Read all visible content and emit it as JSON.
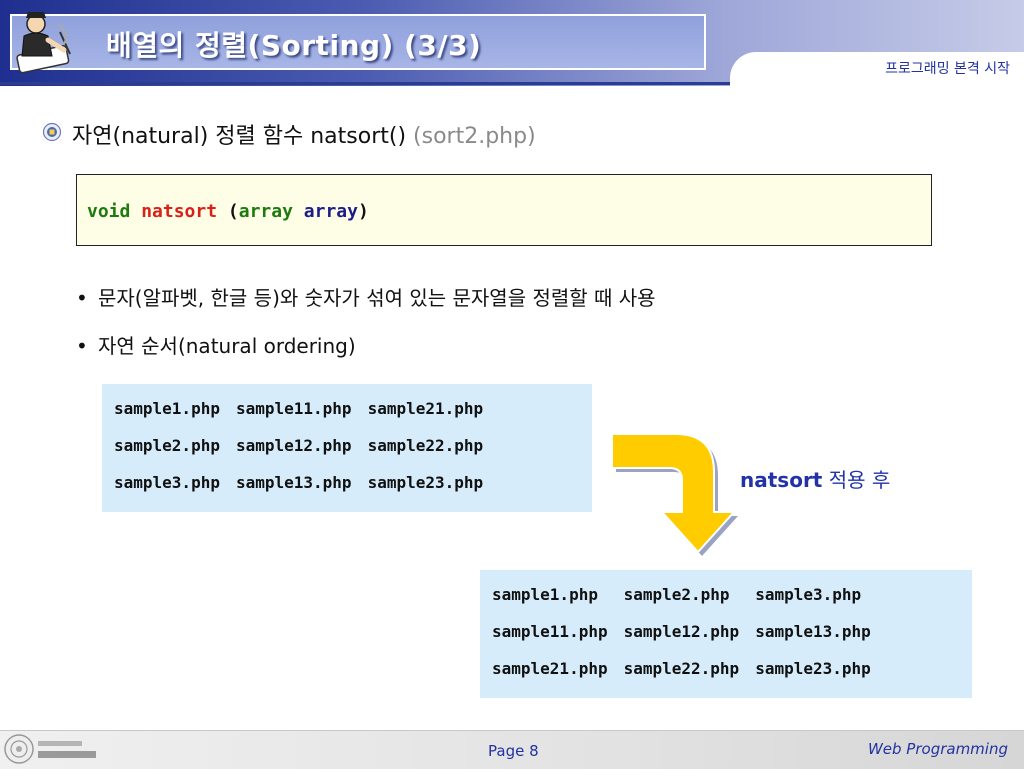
{
  "header": {
    "title": "배열의 정렬(Sorting) (3/3)",
    "subtitle": "프로그래밍 본격 시작"
  },
  "main_bullet": {
    "text": "자연(natural) 정렬 함수 natsort() ",
    "file": "(sort2.php)"
  },
  "code": {
    "kw_void": "void",
    "fn_name": "natsort",
    "paren_open": "(",
    "kw_array": "array",
    "param": "array",
    "paren_close": ")"
  },
  "bullets": [
    "문자(알파벳, 한글 등)와 숫자가 섞여 있는 문자열을 정렬할 때 사용",
    "자연 순서(natural ordering)"
  ],
  "before_table": [
    [
      "sample1.php",
      "sample11.php",
      "sample21.php"
    ],
    [
      "sample2.php",
      "sample12.php",
      "sample22.php"
    ],
    [
      "sample3.php",
      "sample13.php",
      "sample23.php"
    ]
  ],
  "after_table": [
    [
      "sample1.php",
      "sample2.php",
      "sample3.php"
    ],
    [
      "sample11.php",
      "sample12.php",
      "sample13.php"
    ],
    [
      "sample21.php",
      "sample22.php",
      "sample23.php"
    ]
  ],
  "after_label": {
    "fn": "natsort",
    "text": " 적용 후"
  },
  "footer": {
    "page": "Page 8",
    "course": "Web Programming"
  },
  "colors": {
    "header_dark": "#1f2f8f",
    "code_bg": "#fefee6",
    "table_bg": "#d6ecfb",
    "arrow": "#ffcc00",
    "accent_blue": "#2233a8"
  }
}
